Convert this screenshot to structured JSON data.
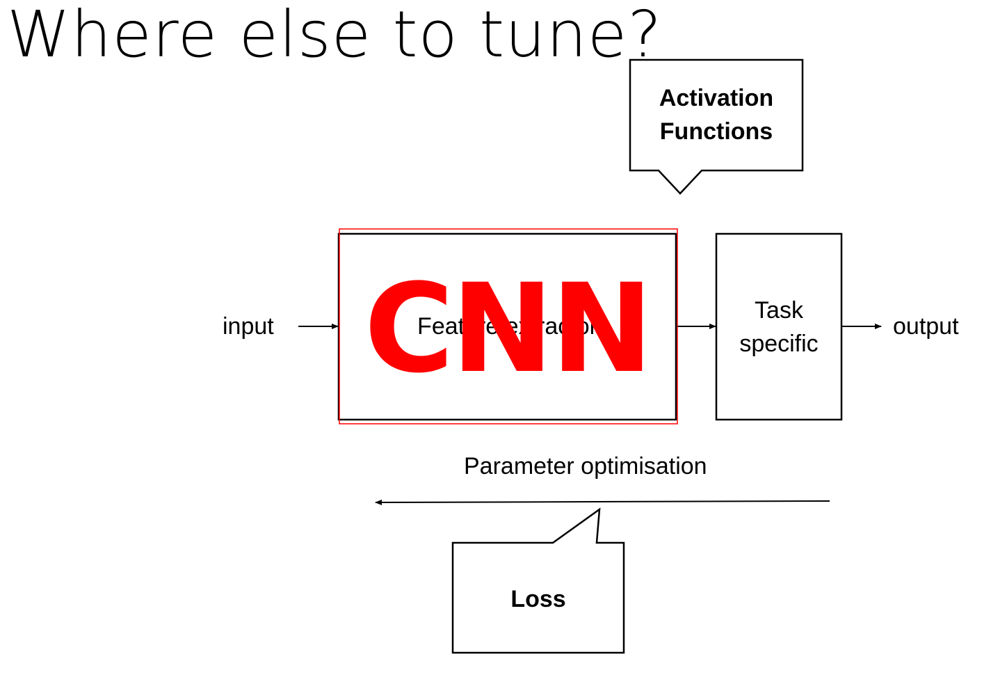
{
  "slide": {
    "title": "Where else to tune?",
    "input_label": "input",
    "output_label": "output",
    "feature_box_label": "Feature extractor",
    "cnn_overlay": "CNN",
    "task_box_line1": "Task",
    "task_box_line2": "specific",
    "param_label": "Parameter optimisation",
    "callout_activation_line1": "Activation",
    "callout_activation_line2": "Functions",
    "callout_loss": "Loss"
  },
  "colors": {
    "overlay": "#ff0000",
    "lines": "#000000",
    "background": "#ffffff"
  }
}
